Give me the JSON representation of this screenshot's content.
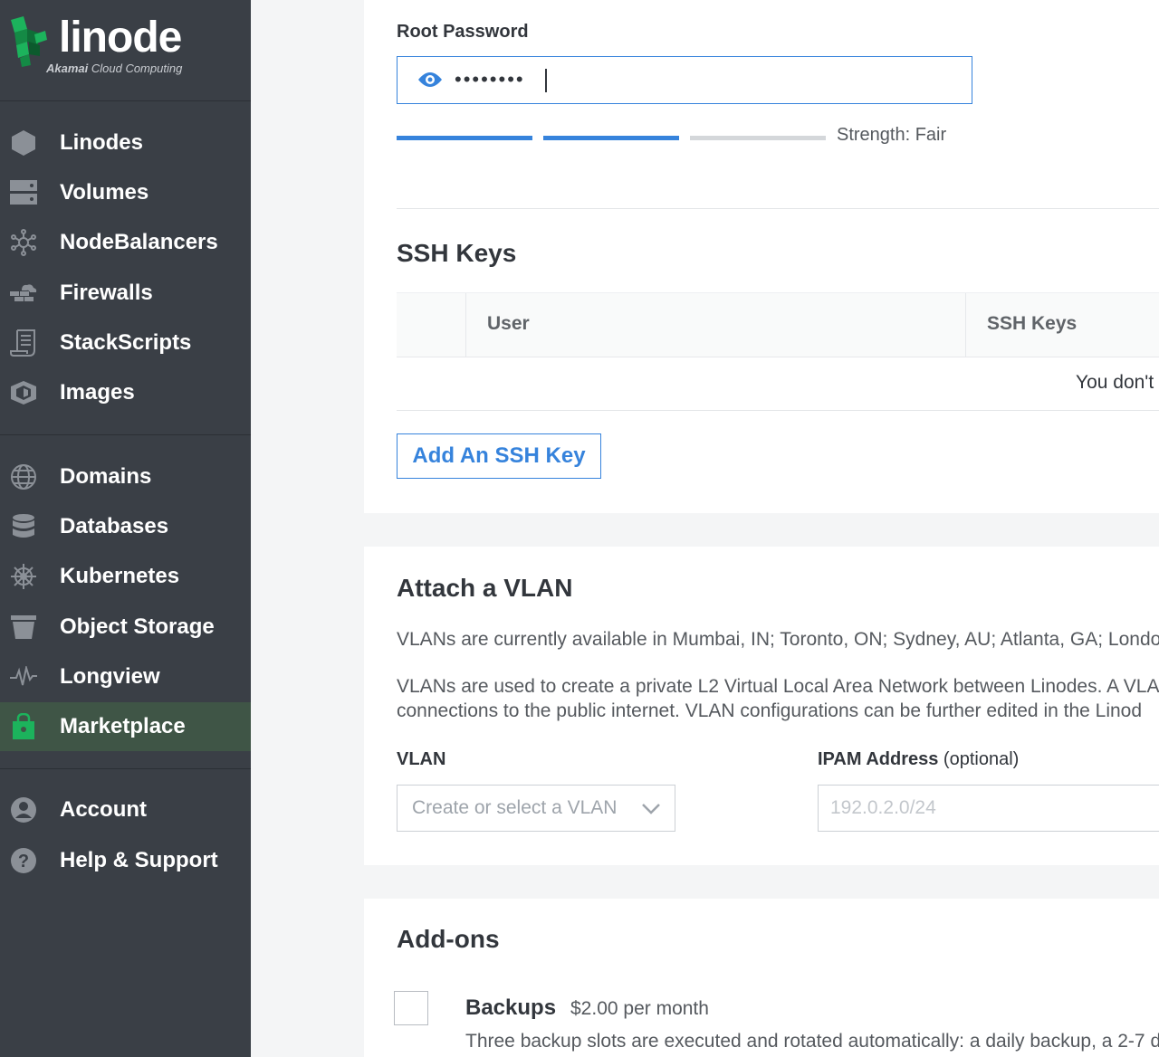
{
  "brand": {
    "wordmark": "linode",
    "sub_bold": "Akamai",
    "sub_rest": " Cloud Computing"
  },
  "colors": {
    "sidebar_bg": "#3a3f46",
    "active_bg": "#3f5546",
    "accent": "#3683dc",
    "brand_green": "#1cb35c"
  },
  "sidebar": {
    "items": [
      {
        "label": "Linodes",
        "icon": "hexagon-icon"
      },
      {
        "label": "Volumes",
        "icon": "volumes-icon"
      },
      {
        "label": "NodeBalancers",
        "icon": "nodebalancer-icon"
      },
      {
        "label": "Firewalls",
        "icon": "firewall-icon"
      },
      {
        "label": "StackScripts",
        "icon": "scroll-icon"
      },
      {
        "label": "Images",
        "icon": "images-icon"
      },
      {
        "label": "Domains",
        "icon": "globe-icon"
      },
      {
        "label": "Databases",
        "icon": "database-icon"
      },
      {
        "label": "Kubernetes",
        "icon": "helm-icon"
      },
      {
        "label": "Object Storage",
        "icon": "bucket-icon"
      },
      {
        "label": "Longview",
        "icon": "pulse-icon"
      },
      {
        "label": "Marketplace",
        "icon": "shopping-bag-icon",
        "active": true
      },
      {
        "label": "Account",
        "icon": "user-icon"
      },
      {
        "label": "Help & Support",
        "icon": "help-icon"
      }
    ]
  },
  "root_password": {
    "label": "Root Password",
    "value_masked": "••••••••",
    "strength_text": "Strength: Fair",
    "strength_filled": 2,
    "strength_total": 3
  },
  "ssh": {
    "title": "SSH Keys",
    "col_user": "User",
    "col_keys": "SSH Keys",
    "empty_message": "You don't",
    "add_button": "Add An SSH Key"
  },
  "vlan": {
    "title": "Attach a VLAN",
    "availability": "VLANs are currently available in Mumbai, IN; Toronto, ON; Sydney, AU; Atlanta, GA; Londo",
    "desc_line1": "VLANs are used to create a private L2 Virtual Local Area Network between Linodes. A VLA",
    "desc_line2": "connections to the public internet. VLAN configurations can be further edited in the Linod",
    "vlan_label": "VLAN",
    "vlan_placeholder": "Create or select a VLAN",
    "ipam_label": "IPAM Address",
    "ipam_optional": " (optional)",
    "ipam_placeholder": "192.0.2.0/24"
  },
  "addons": {
    "title": "Add-ons",
    "backups_title": "Backups",
    "backups_price": "$2.00 per month",
    "backups_desc": "Three backup slots are executed and rotated automatically: a daily backup, a 2-7 d"
  }
}
